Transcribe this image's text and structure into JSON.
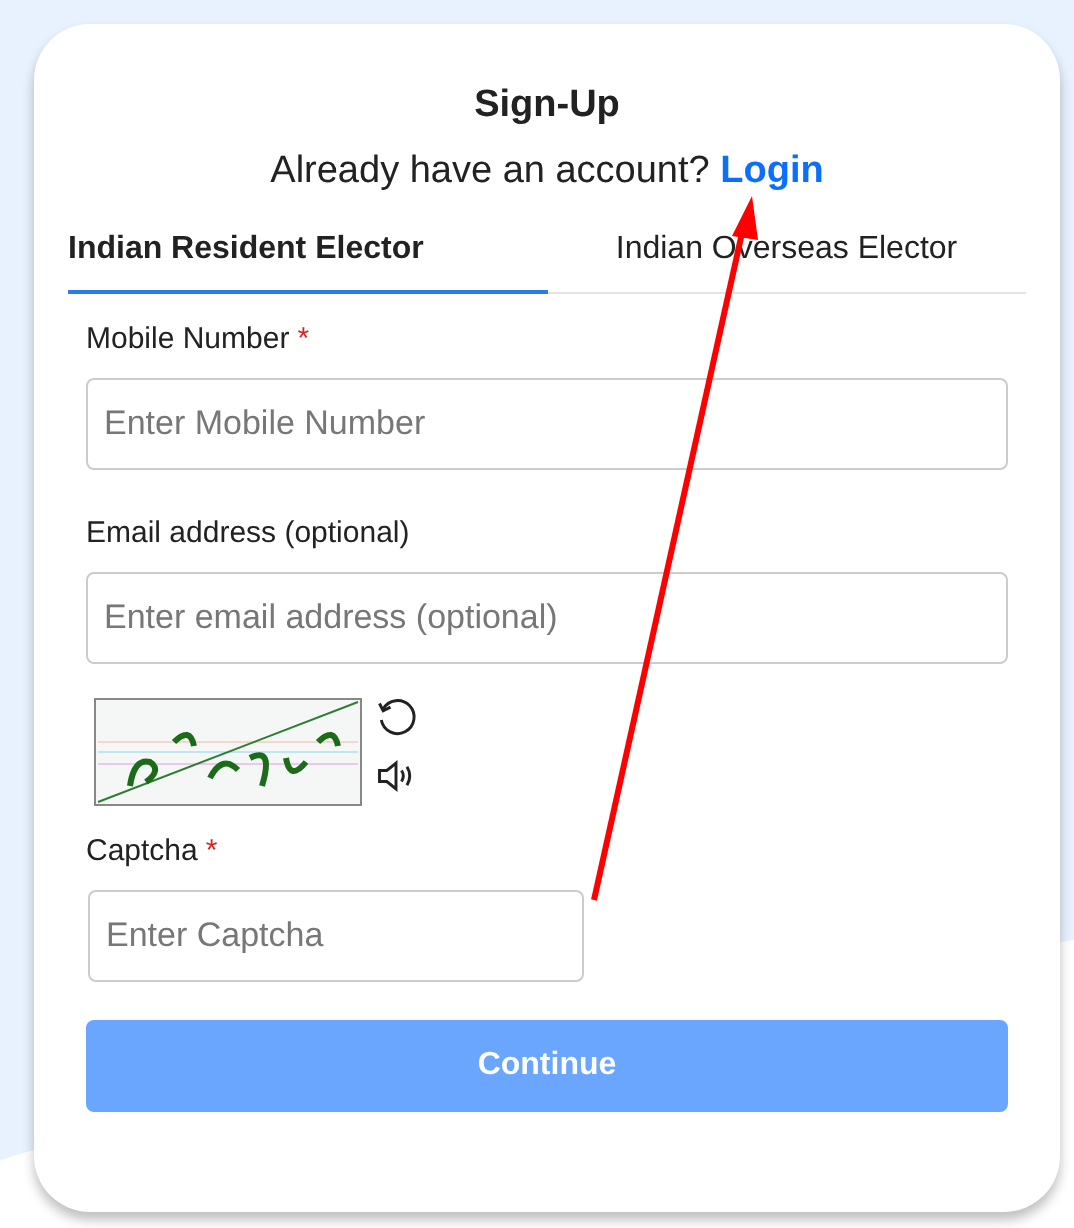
{
  "title": "Sign-Up",
  "login_prompt": {
    "text": "Already have an account?",
    "link": "Login"
  },
  "tabs": [
    {
      "label": "Indian Resident Elector",
      "selected": true
    },
    {
      "label": "Indian Overseas Elector",
      "selected": false
    }
  ],
  "fields": [
    {
      "label": "Mobile Number",
      "required_mark": "*",
      "placeholder": "Enter Mobile Number"
    },
    {
      "label": "Email address (optional)",
      "placeholder": "Enter email address (optional)"
    }
  ],
  "captcha": {
    "label": "Captcha",
    "required_mark": "*",
    "placeholder": "Enter Captcha"
  },
  "button": {
    "label": "Continue",
    "disabled": true
  },
  "annotation": {
    "kind": "arrow",
    "color": "#ff0000"
  }
}
